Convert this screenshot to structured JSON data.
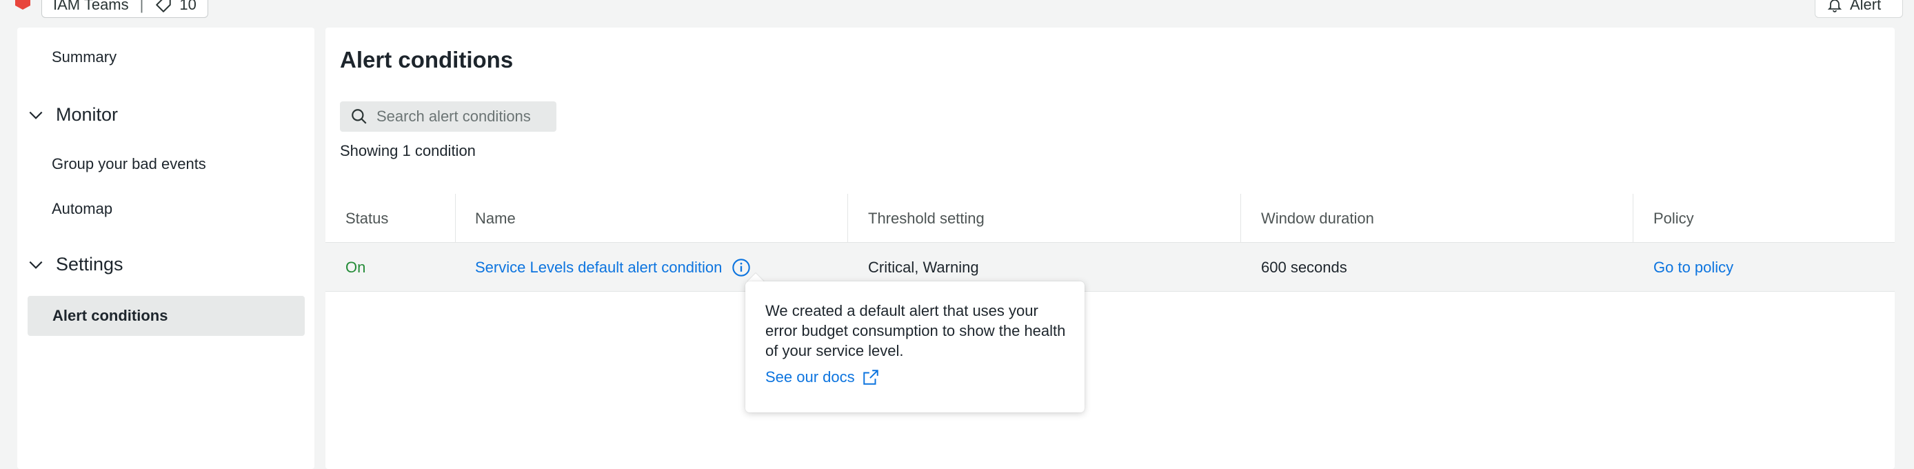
{
  "topbar": {
    "entity_name": "IAM Teams",
    "separator": "|",
    "tag_count": "10",
    "alert_button": "Alert"
  },
  "sidebar": {
    "summary": "Summary",
    "monitor_section": "Monitor",
    "monitor_items": [
      "Group your bad events",
      "Automap"
    ],
    "settings_section": "Settings",
    "settings_items": [
      "Alert conditions"
    ]
  },
  "main": {
    "title": "Alert conditions",
    "search_placeholder": "Search alert conditions",
    "showing_text": "Showing 1 condition",
    "table": {
      "columns": [
        "Status",
        "Name",
        "Threshold setting",
        "Window duration",
        "Policy"
      ],
      "rows": [
        {
          "status": "On",
          "name": "Service Levels default alert condition",
          "threshold": "Critical, Warning",
          "window": "600 seconds",
          "policy": "Go to policy"
        }
      ]
    },
    "tooltip": {
      "text": "We created a default alert that uses your error budget consumption to show the health of your service level.",
      "link": "See our docs"
    }
  },
  "colors": {
    "accent_link": "#0c74df",
    "status_on": "#248c38",
    "brand_icon": "#e8453c",
    "page_bg": "#f3f4f4"
  },
  "icons": [
    "brand-hexagon-icon",
    "tag-icon",
    "bell-icon",
    "chevron-down-icon",
    "search-icon",
    "info-icon",
    "external-link-icon"
  ]
}
